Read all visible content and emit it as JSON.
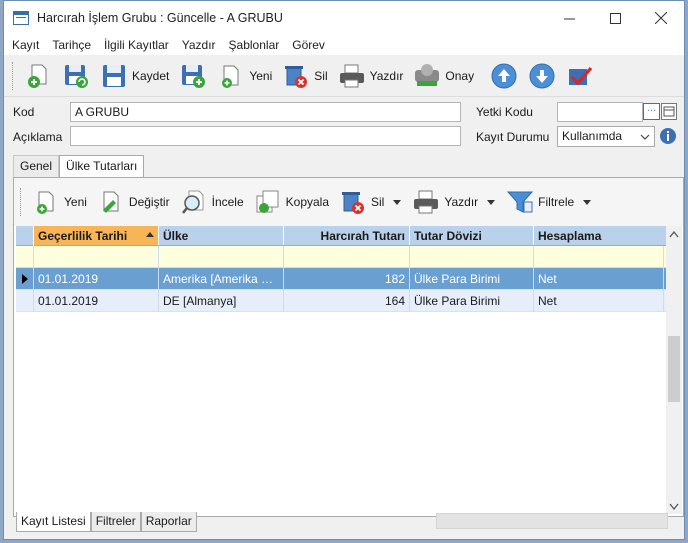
{
  "window": {
    "title": "Harcırah İşlem Grubu : Güncelle - A GRUBU"
  },
  "menu": [
    "Kayıt",
    "Tarihçe",
    "İlgili Kayıtlar",
    "Yazdır",
    "Şablonlar",
    "Görev"
  ],
  "toolbar": {
    "save": "Kaydet",
    "new": "Yeni",
    "delete": "Sil",
    "print": "Yazdır",
    "approve": "Onay"
  },
  "form": {
    "kod_label": "Kod",
    "kod_value": "A GRUBU",
    "aciklama_label": "Açıklama",
    "aciklama_value": "",
    "yetki_label": "Yetki Kodu",
    "yetki_value": "",
    "durum_label": "Kayıt Durumu",
    "durum_value": "Kullanımda"
  },
  "tabs": [
    "Genel",
    "Ülke Tutarları"
  ],
  "subtoolbar": {
    "new": "Yeni",
    "change": "Değiştir",
    "inspect": "İncele",
    "copy": "Kopyala",
    "delete": "Sil",
    "print": "Yazdır",
    "filter": "Filtrele"
  },
  "grid": {
    "columns": [
      "Geçerlilik Tarihi",
      "Ülke",
      "Harcırah Tutarı",
      "Tutar Dövizi",
      "Hesaplama"
    ],
    "rows": [
      {
        "date": "01.01.2019",
        "country": "Amerika [Amerika Bi...",
        "amount": "182",
        "currency": "Ülke Para Birimi",
        "calc": "Net"
      },
      {
        "date": "01.01.2019",
        "country": "DE [Almanya]",
        "amount": "164",
        "currency": "Ülke Para Birimi",
        "calc": "Net"
      }
    ]
  },
  "bottom_tabs": [
    "Kayıt Listesi",
    "Filtreler",
    "Raporlar"
  ]
}
